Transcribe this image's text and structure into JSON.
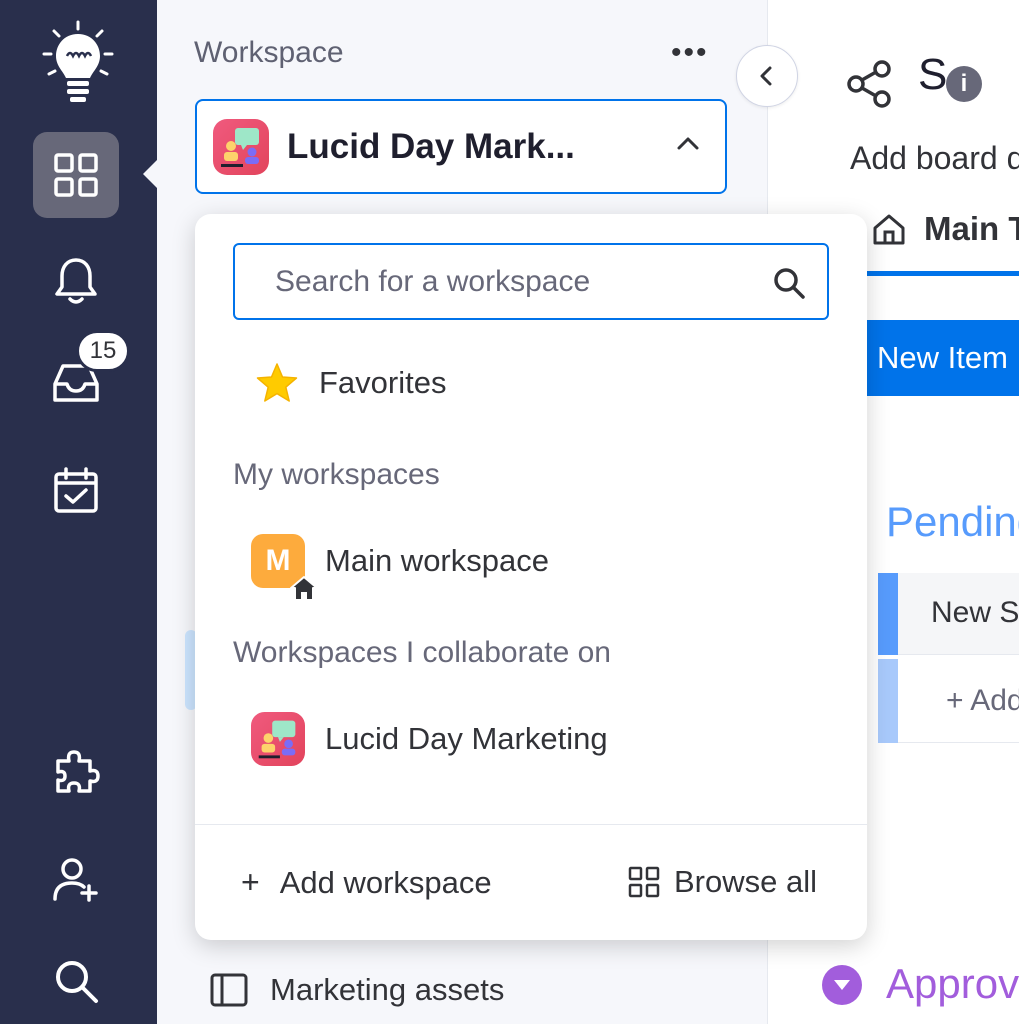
{
  "rail": {
    "notifications_badge": "15"
  },
  "sidebar": {
    "title": "Workspace",
    "more": "•••",
    "selected_workspace": "Lucid Day Mark...",
    "bottom_item": "Marketing assets"
  },
  "main": {
    "title_fragment": "S",
    "add_board": "Add board d",
    "tab": "Main T",
    "new_item": "New Item",
    "group_title": "Pending",
    "row1": "New S",
    "row2": "+ Add",
    "group2_title": "Approv"
  },
  "dropdown": {
    "search_placeholder": "Search for a workspace",
    "favorites": "Favorites",
    "my_workspaces_heading": "My workspaces",
    "my_workspaces": [
      {
        "initial": "M",
        "label": "Main workspace"
      }
    ],
    "collab_heading": "Workspaces I collaborate on",
    "collab_workspaces": [
      {
        "label": "Lucid Day Marketing"
      }
    ],
    "add_workspace": "Add workspace",
    "browse_all": "Browse all"
  },
  "colors": {
    "rail_bg": "#292f4c",
    "accent": "#0073ea",
    "pending": "#579bfc",
    "approve": "#a25ddc",
    "m_avatar": "#fdab3d"
  }
}
